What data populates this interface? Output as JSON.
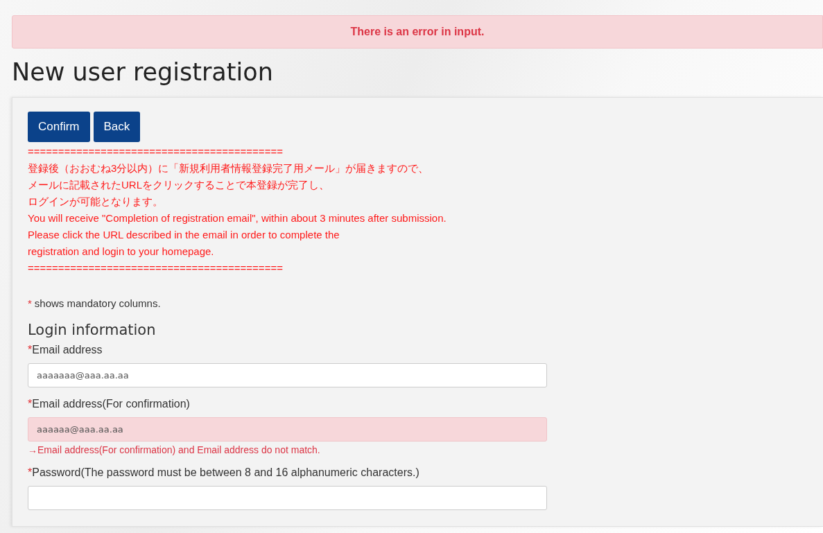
{
  "alert": {
    "text": "There is an error in input."
  },
  "title": "New user registration",
  "buttons": [
    {
      "label": "Confirm"
    },
    {
      "label": "Back"
    }
  ],
  "notice": [
    "==========================================",
    "登録後（おおむね3分以内）に「新規利用者情報登録完了用メール」が届きますので、",
    "メールに記載されたURLをクリックすることで本登録が完了し、",
    "ログインが可能となります。",
    "You will receive \"Completion of registration email\", within about 3 minutes after submission.",
    "Please click the URL described in the email in order to complete the",
    "registration and login to your homepage.",
    "=========================================="
  ],
  "mandatory_note": {
    "mark": "*",
    "text": "shows mandatory columns."
  },
  "section": {
    "title": "Login information",
    "fields": [
      {
        "mark": "*",
        "label": "Email address",
        "value": "aaaaaaa@aaa.aa.aa",
        "error": false
      },
      {
        "mark": "*",
        "label": "Email address(For confirmation)",
        "value": "aaaaaa@aaa.aa.aa",
        "error": true,
        "message": "→Email address(For confirmation) and Email address do not match."
      },
      {
        "mark": "*",
        "label": "Password(The password must be between 8 and 16 alphanumeric characters.)",
        "error": false
      }
    ]
  }
}
